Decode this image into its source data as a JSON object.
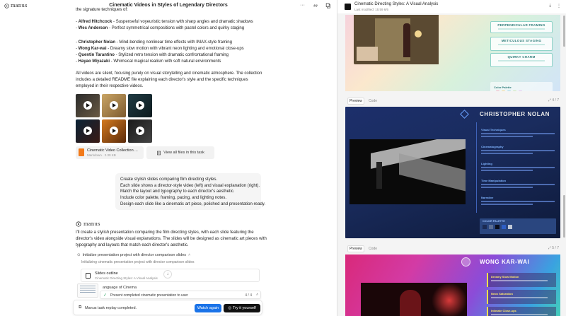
{
  "left": {
    "logo_text": "manus",
    "chat_title": "Cinematic Videos in Styles of Legendary Directors",
    "intro_text": "the signature techniques of:",
    "directors_group1": [
      {
        "name": "Alfred Hitchcock",
        "desc": " - Suspenseful voyeuristic tension with sharp angles and dramatic shadows"
      },
      {
        "name": "Wes Anderson",
        "desc": " - Perfect symmetrical compositions with pastel colors and quirky staging"
      }
    ],
    "directors_group2": [
      {
        "name": "Christopher Nolan",
        "desc": " - Mind-bending nonlinear time effects with IMAX-style framing"
      },
      {
        "name": "Wong Kar-wai",
        "desc": " - Dreamy slow motion with vibrant neon lighting and emotional close-ups"
      },
      {
        "name": "Quentin Tarantino",
        "desc": " - Stylized retro tension with dramatic confrontational framing"
      },
      {
        "name": "Hayao Miyazaki",
        "desc": " - Whimsical magical realism with soft natural environments"
      }
    ],
    "summary_text": "All videos are silent, focusing purely on visual storytelling and cinematic atmosphere. The collection includes a detailed README file explaining each director's style and the specific techniques employed in their respective videos.",
    "file_card": {
      "name": "Cinematic Video Collection ...",
      "meta": "Markdown · 2.30 KB"
    },
    "view_all_label": "View all files in this task",
    "user_message_lines": [
      "Create stylish slides comparing film directing styles.",
      "Each slide shows a director-style video (left) and visual explanation (right).",
      "Match the layout and typography to each director's aesthetic.",
      "Include color palette, framing, pacing, and lighting notes.",
      "Design each slide like a cinematic art piece, polished and presentation-ready."
    ],
    "assistant_name": "manus",
    "assistant_reply": "I'll create a stylish presentation comparing the film directing styles, with each slide featuring the director's video alongside visual explanations. The slides will be designed as cinematic art pieces with typography and layouts that match each director's aesthetic.",
    "step_title": "Initialize presentation project with director comparison slides",
    "step_sub": "Initializing cinematic presentation project with director comparison slides",
    "outline_card": {
      "title": "Slides outline",
      "subtitle": "Cinematic Directing Styles: A Visual Analysis"
    },
    "lang_text": "anguage of Cinema",
    "status_text": "Present completed cinematic presentation to user",
    "status_count": "4 / 4",
    "replay_text": "Manus task replay completed.",
    "watch_again_label": "Watch again",
    "try_label": "Try it yourself"
  },
  "right": {
    "title": "Cinematic Directing Styles: A Visual Analysis",
    "modified": "Last modified: 15:59 6/6",
    "slide1": {
      "cards": [
        "PERPENDICULAR FRAMING",
        "METICULOUS STAGING",
        "QUIRKY CHARM"
      ],
      "palette_label": "Color Palette",
      "palette": [
        "#f2b8c6",
        "#f6d89b",
        "#a9d8e8",
        "#cfe6b8",
        "#e6c9f0"
      ]
    },
    "tabs1": {
      "preview": "Preview",
      "code": "Code",
      "page": "4 / 7"
    },
    "slide2": {
      "title": "CHRISTOPHER NOLAN",
      "sections": [
        "Visual Techniques",
        "Cinematography",
        "Lighting",
        "Time Manipulation",
        "Narrative"
      ],
      "palette_label": "COLOR PALETTE",
      "palette": [
        "#1b2b54",
        "#5a6e96",
        "#0a0f1e",
        "#2f5ec4",
        "#bfc7d6"
      ]
    },
    "tabs2": {
      "preview": "Preview",
      "code": "Code",
      "page": "5 / 7"
    },
    "slide3": {
      "title": "WONG KAR-WAI",
      "cards": [
        "Dreamy Slow Motion",
        "Neon Saturation",
        "Intimate Close-ups"
      ]
    }
  }
}
